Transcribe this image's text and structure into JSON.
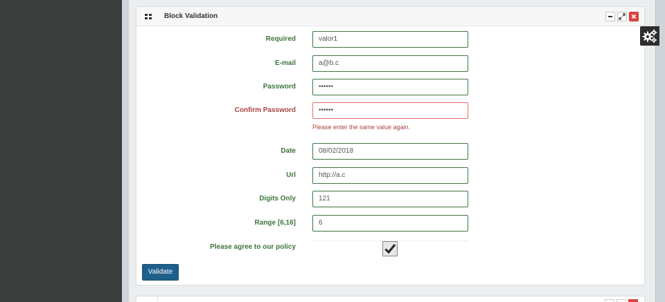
{
  "panel": {
    "title": "Block Validation",
    "controls": {
      "minimize_icon": "minus-icon",
      "expand_icon": "expand-icon",
      "close_icon": "close-icon"
    },
    "grid_icon": "grid-icon"
  },
  "settings": {
    "icon": "gears-icon"
  },
  "form": {
    "required": {
      "label": "Required",
      "value": "valor1"
    },
    "email": {
      "label": "E-mail",
      "value": "a@b.c"
    },
    "password": {
      "label": "Password",
      "value": "••••••"
    },
    "confirm_password": {
      "label": "Confirm Password",
      "value": "••••••",
      "error": "Please enter the same value again."
    },
    "date": {
      "label": "Date",
      "value": "08/02/2018"
    },
    "url": {
      "label": "Url",
      "value": "http://a.c"
    },
    "digits": {
      "label": "Digits Only",
      "value": "121"
    },
    "range": {
      "label": "Range [6,16]",
      "value": "6"
    },
    "policy": {
      "label": "Please agree to our policy",
      "checked": true
    },
    "submit_label": "Validate"
  },
  "colors": {
    "valid": "#3c763d",
    "error": "#a94442",
    "button": "#1f5f8b",
    "sidebar": "#393d3c"
  }
}
